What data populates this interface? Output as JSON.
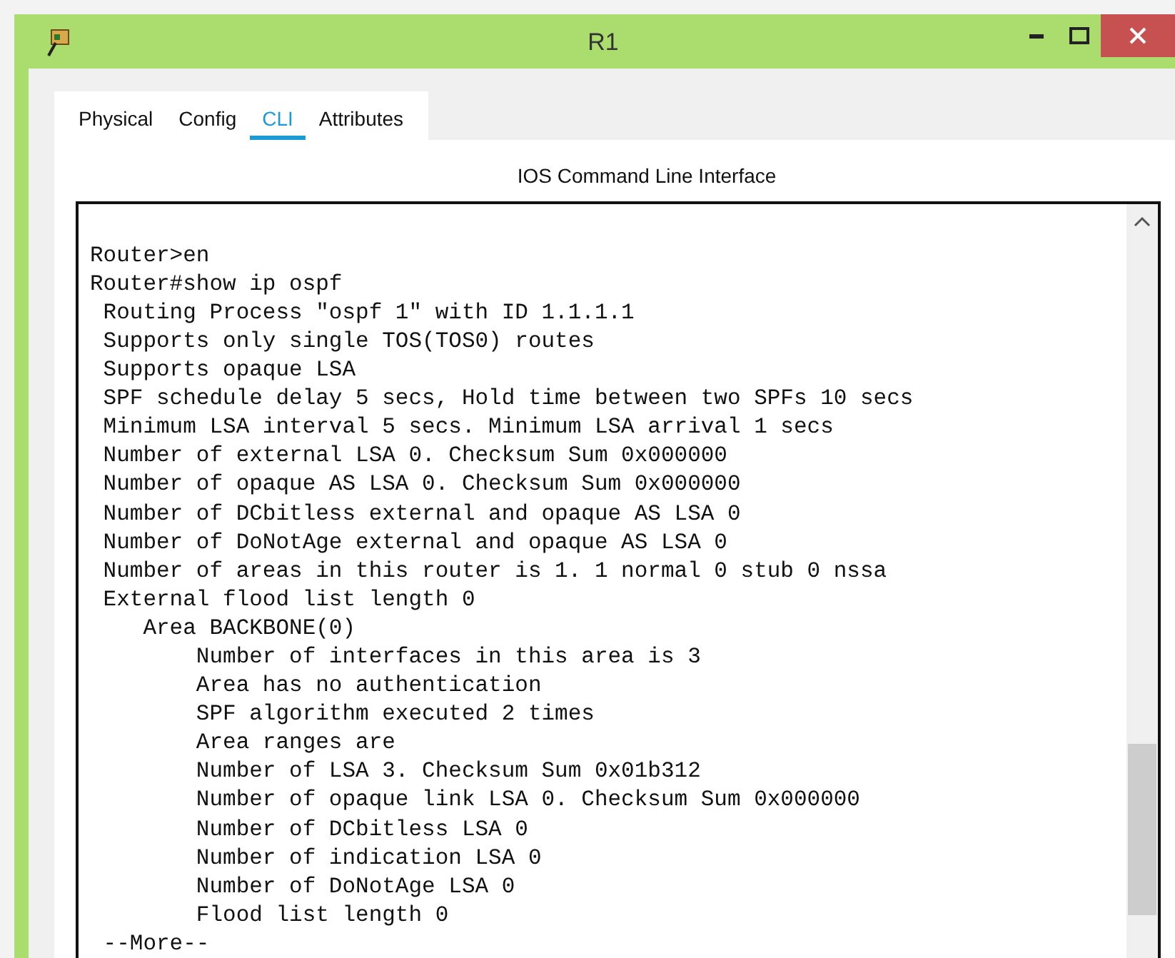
{
  "window": {
    "title": "R1"
  },
  "tabs": [
    {
      "label": "Physical",
      "selected": false
    },
    {
      "label": "Config",
      "selected": false
    },
    {
      "label": "CLI",
      "selected": true
    },
    {
      "label": "Attributes",
      "selected": false
    }
  ],
  "panel_title": "IOS Command Line Interface",
  "terminal": {
    "lines": [
      "Router>en",
      "Router#show ip ospf",
      " Routing Process \"ospf 1\" with ID 1.1.1.1",
      " Supports only single TOS(TOS0) routes",
      " Supports opaque LSA",
      " SPF schedule delay 5 secs, Hold time between two SPFs 10 secs",
      " Minimum LSA interval 5 secs. Minimum LSA arrival 1 secs",
      " Number of external LSA 0. Checksum Sum 0x000000",
      " Number of opaque AS LSA 0. Checksum Sum 0x000000",
      " Number of DCbitless external and opaque AS LSA 0",
      " Number of DoNotAge external and opaque AS LSA 0",
      " Number of areas in this router is 1. 1 normal 0 stub 0 nssa",
      " External flood list length 0",
      "    Area BACKBONE(0)",
      "        Number of interfaces in this area is 3",
      "        Area has no authentication",
      "        SPF algorithm executed 2 times",
      "        Area ranges are",
      "        Number of LSA 3. Checksum Sum 0x01b312",
      "        Number of opaque link LSA 0. Checksum Sum 0x000000",
      "        Number of DCbitless LSA 0",
      "        Number of indication LSA 0",
      "        Number of DoNotAge LSA 0",
      "        Flood list length 0",
      " --More--"
    ]
  }
}
